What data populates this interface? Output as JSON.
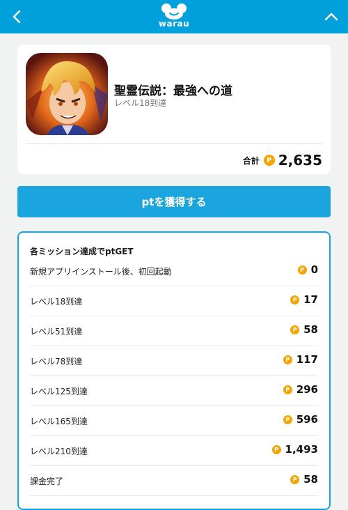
{
  "header": {
    "logo_text": "warau",
    "brand_color": "#00a0dd"
  },
  "app": {
    "title": "聖霊伝説：最強への道",
    "subtitle": "レベル18到達",
    "total_label": "合計",
    "total_points": "2,635"
  },
  "cta": {
    "label": "ptを獲得する",
    "color": "#1aa5de"
  },
  "missions": {
    "title": "各ミッション達成でptGET",
    "point_icon_letter": "P",
    "point_icon_color": "#f5a400",
    "items": [
      {
        "label": "新規アプリインストール後、初回起動",
        "points": "0"
      },
      {
        "label": "レベル18到達",
        "points": "17"
      },
      {
        "label": "レベル51到達",
        "points": "58"
      },
      {
        "label": "レベル78到達",
        "points": "117"
      },
      {
        "label": "レベル125到達",
        "points": "296"
      },
      {
        "label": "レベル165到達",
        "points": "596"
      },
      {
        "label": "レベル210到達",
        "points": "1,493"
      },
      {
        "label": "課金完了",
        "points": "58"
      }
    ]
  }
}
